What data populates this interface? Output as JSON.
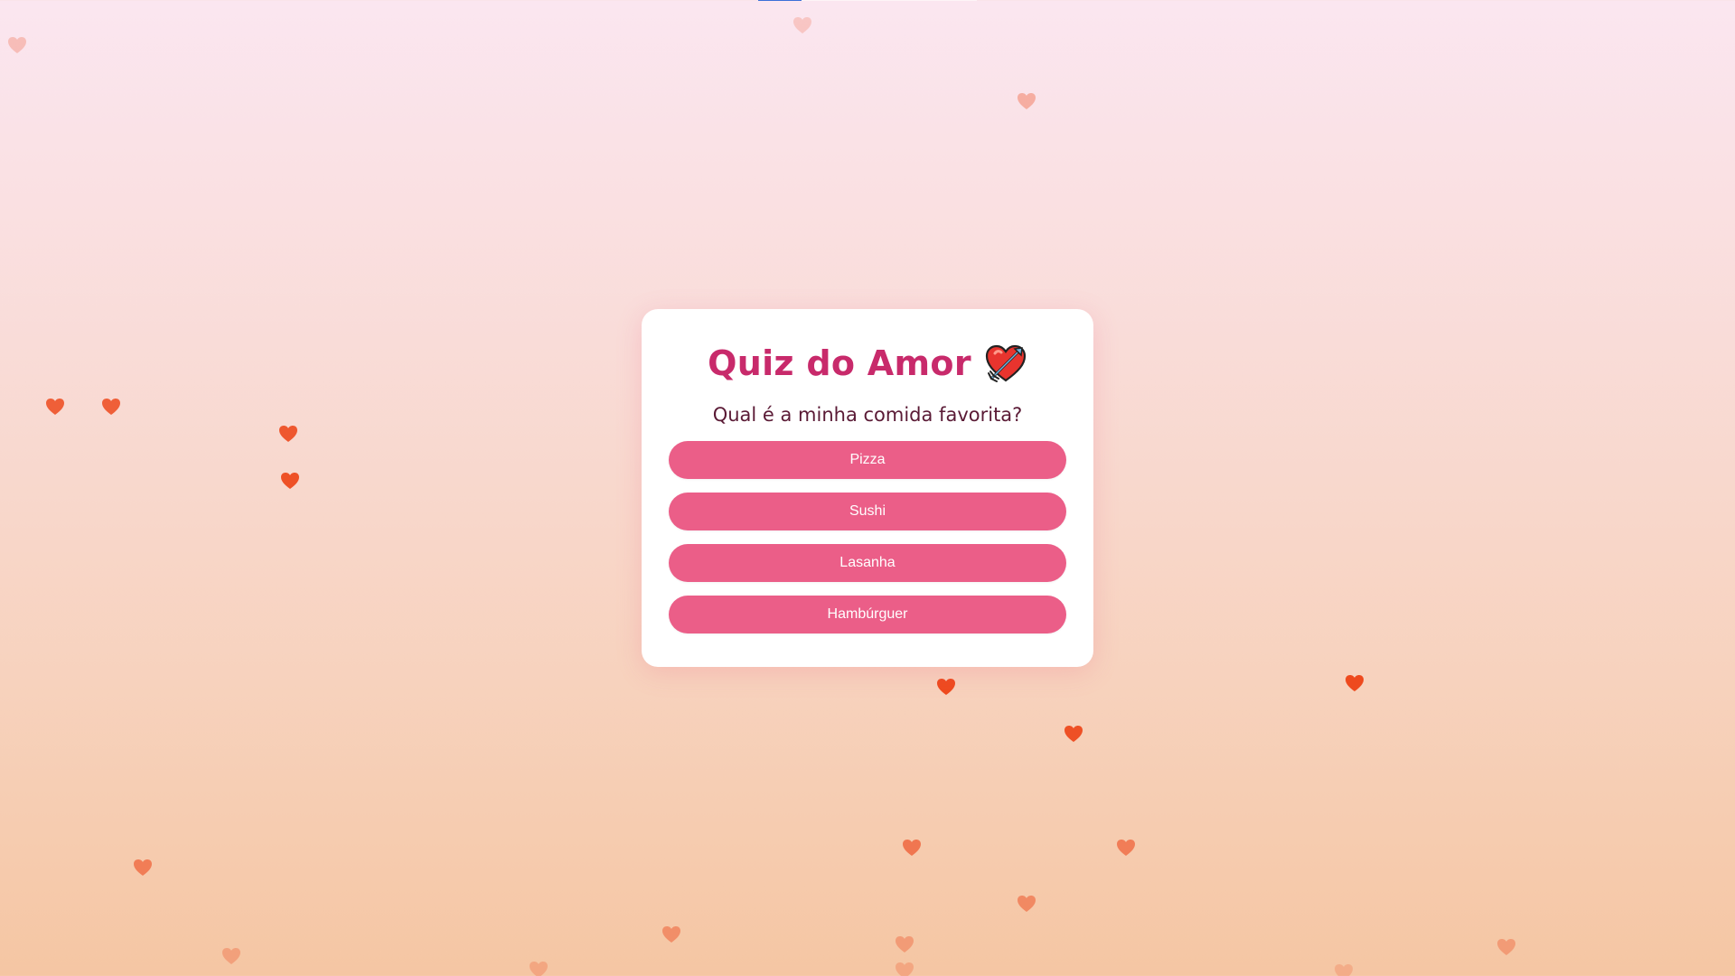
{
  "quiz": {
    "title": "Quiz do Amor",
    "title_icon": "heart-with-arrow-icon",
    "question": "Qual é a minha comida favorita?",
    "options": [
      {
        "label": "Pizza"
      },
      {
        "label": "Sushi"
      },
      {
        "label": "Lasanha"
      },
      {
        "label": "Hambúrguer"
      }
    ]
  },
  "progress": {
    "fraction": 0.2
  },
  "background": {
    "decor_icon": "heart-icon",
    "gradient_top": "#fbe6f0",
    "gradient_bottom": "#f5c6a3"
  },
  "colors": {
    "accent": "#eb5e88",
    "title": "#c82a6b",
    "question_text": "#5a1a35",
    "heart": "#ee4a1e"
  }
}
